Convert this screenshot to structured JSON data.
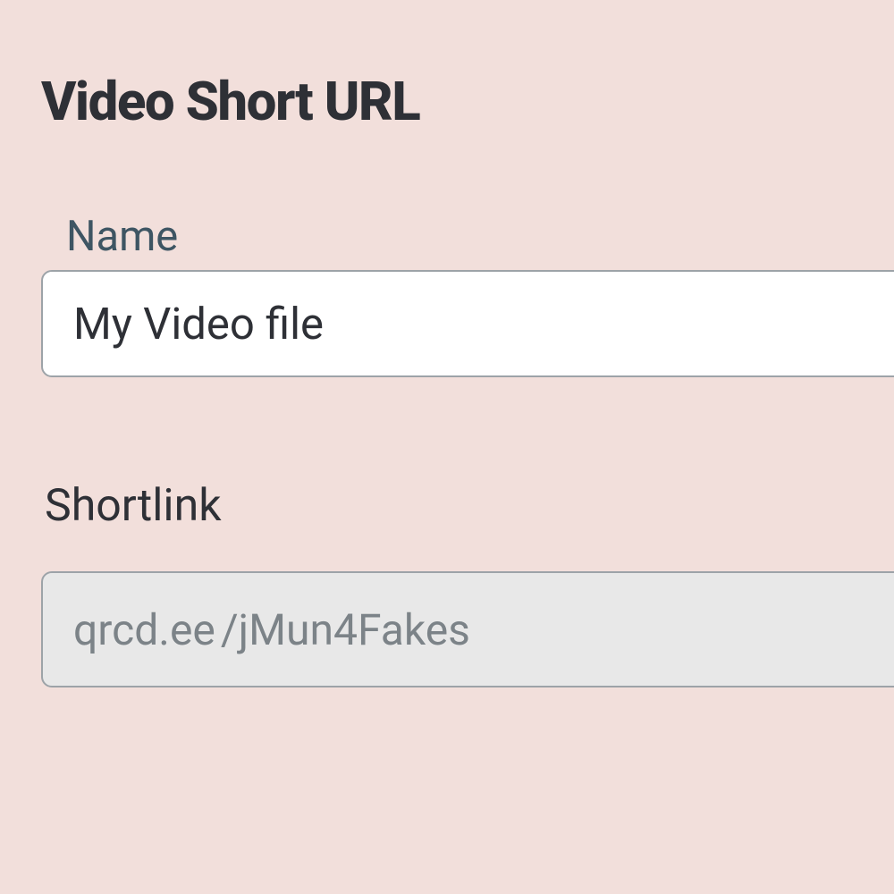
{
  "title": "Video Short URL",
  "nameField": {
    "label": "Name",
    "value": "My Video file"
  },
  "shortlink": {
    "label": "Shortlink",
    "domain": "qrcd.ee",
    "path": "/jMun4Fakes"
  }
}
